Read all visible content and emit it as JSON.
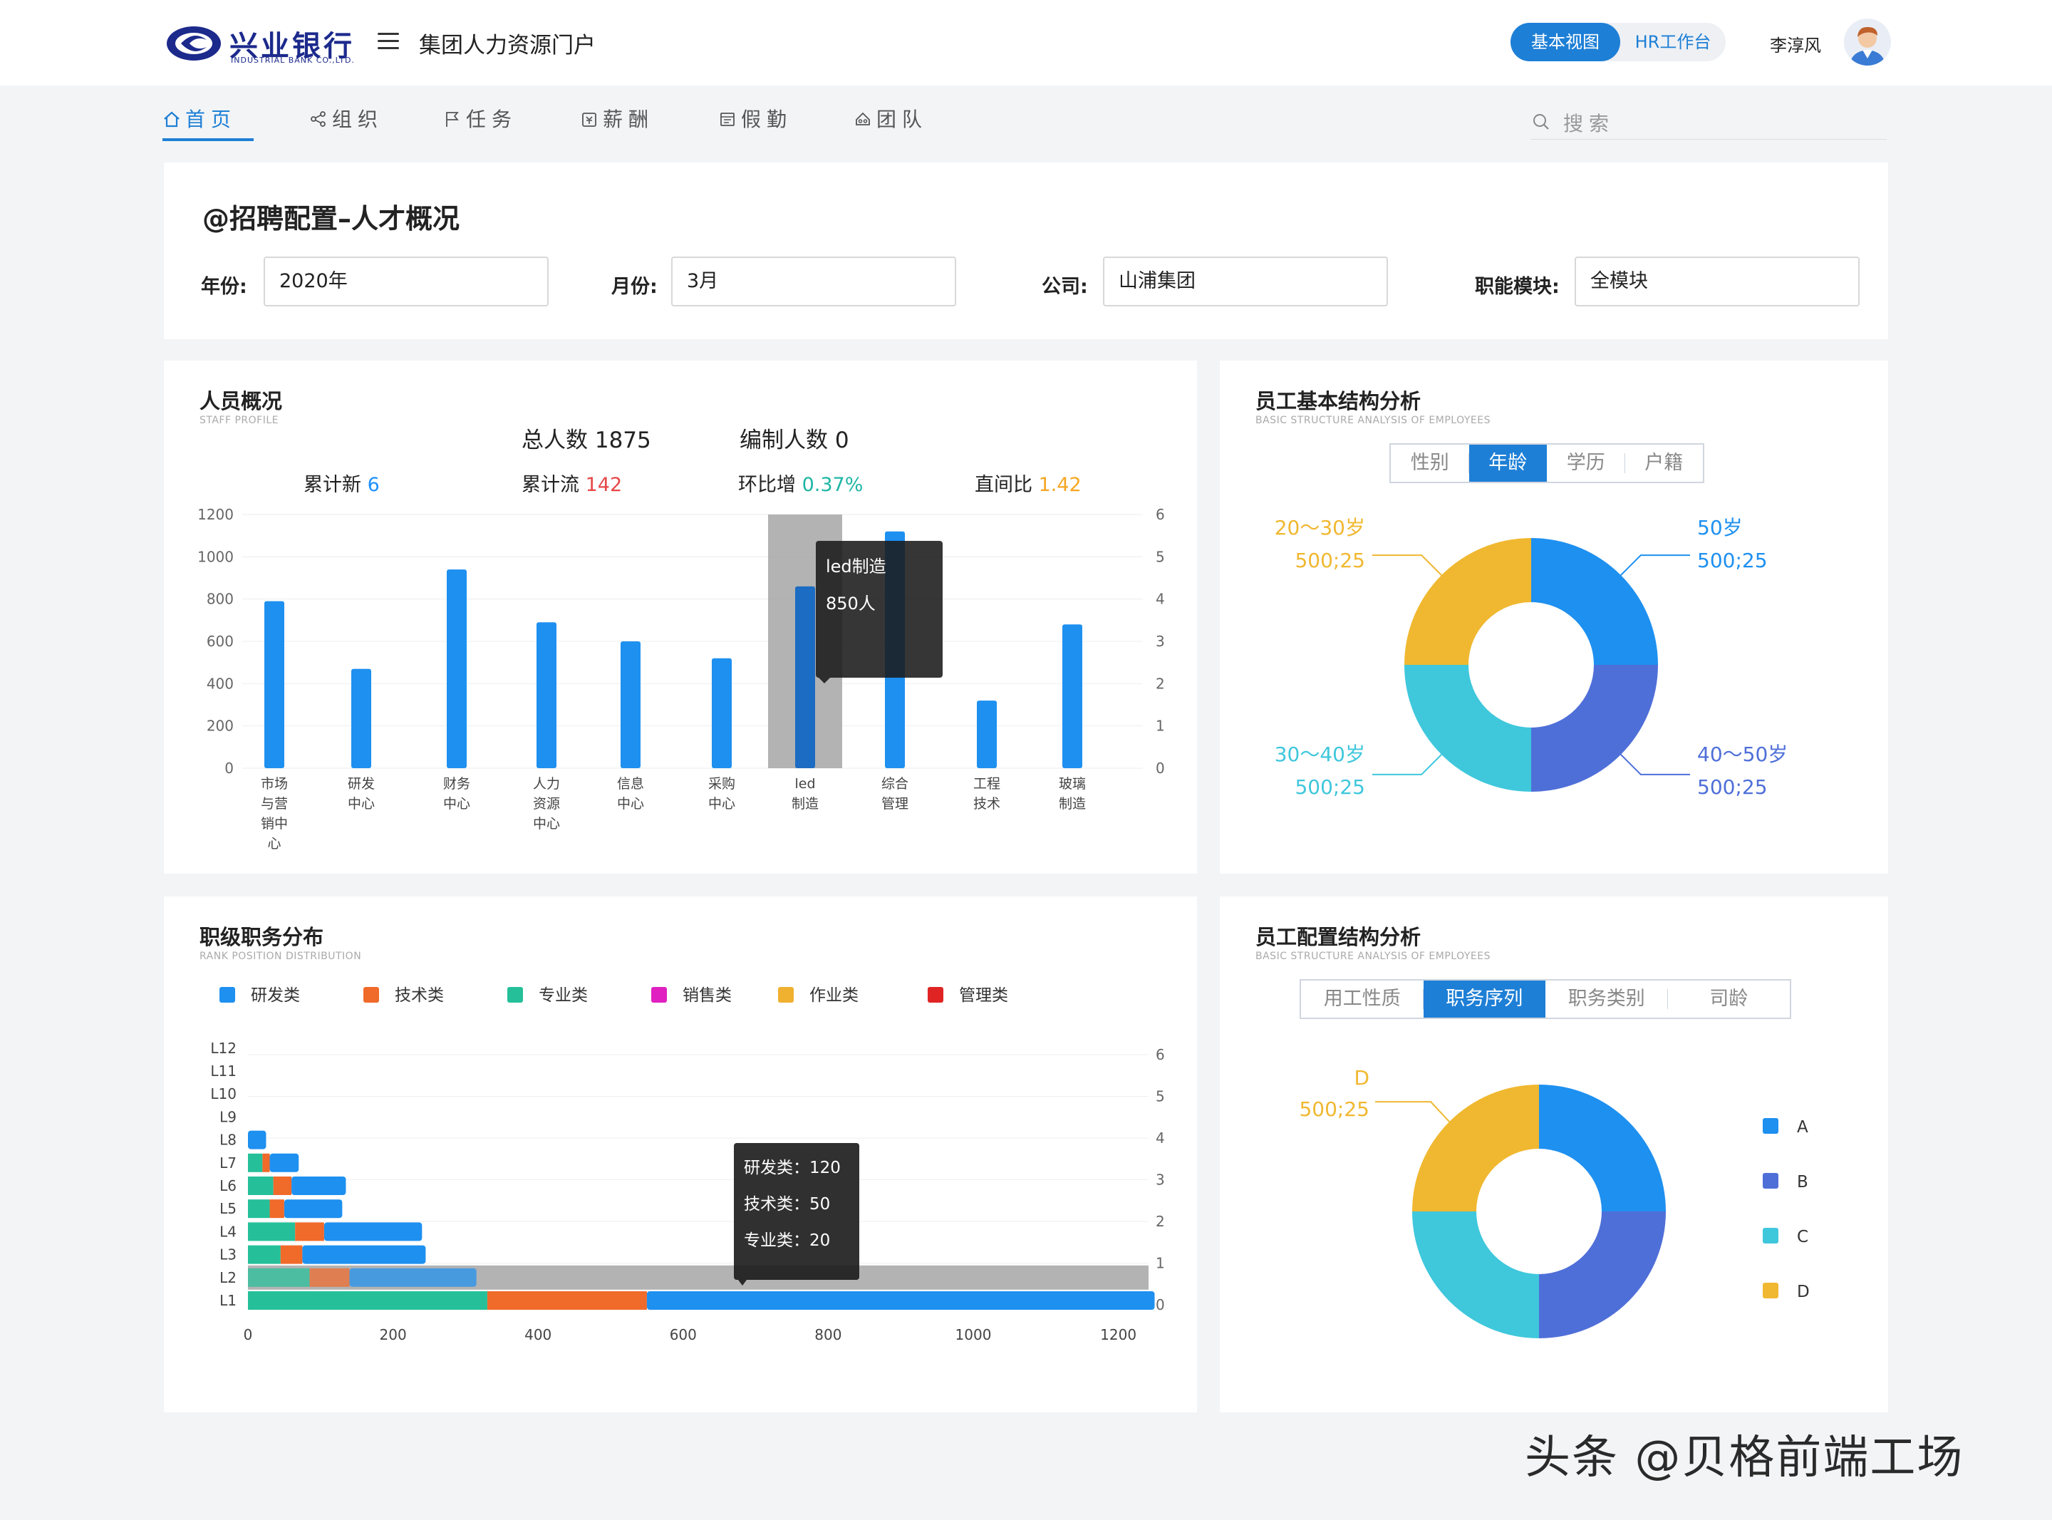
{
  "header": {
    "logo_cn": "兴业银行",
    "logo_en": "INDUSTRIAL BANK CO.,LTD.",
    "portal_title": "集团人力资源门户",
    "view_basic": "基本视图",
    "view_hr": "HR工作台",
    "user_name": "李淳风"
  },
  "nav": {
    "items": [
      {
        "label": "首页",
        "icon": "home-icon"
      },
      {
        "label": "组织",
        "icon": "share-icon"
      },
      {
        "label": "任务",
        "icon": "flag-icon"
      },
      {
        "label": "薪酬",
        "icon": "wallet-icon"
      },
      {
        "label": "假勤",
        "icon": "calendar-icon"
      },
      {
        "label": "团队",
        "icon": "team-icon"
      }
    ],
    "active_index": 0,
    "search_placeholder": "搜索"
  },
  "filter": {
    "title": "@招聘配置–人才概况",
    "year_label": "年份:",
    "year_value": "2020年",
    "month_label": "月份:",
    "month_value": "3月",
    "company_label": "公司:",
    "company_value": "山浦集团",
    "module_label": "职能模块:",
    "module_value": "全模块"
  },
  "staff": {
    "title": "人员概况",
    "subtitle": "STAFF PROFILE",
    "total_label": "总人数",
    "total_value": "1875",
    "quota_label": "编制人数",
    "quota_value": "0",
    "new_label": "累计新",
    "new_value": "6",
    "outflow_label": "累计流",
    "outflow_value": "142",
    "mom_label": "环比增",
    "mom_value": "0.37%",
    "ratio_label": "直间比",
    "ratio_value": "1.42",
    "tooltip_title": "led制造",
    "tooltip_value": "850人"
  },
  "basic": {
    "title": "员工基本结构分析",
    "subtitle": "BASIC STRUCTURE ANALYSIS OF EMPLOYEES",
    "tabs": [
      "性别",
      "年龄",
      "学历",
      "户籍"
    ],
    "active_tab": 1
  },
  "rank": {
    "title": "职级职务分布",
    "subtitle": "RANK POSITION DISTRIBUTION",
    "tooltip": [
      {
        "label": "研发类：",
        "value": "120"
      },
      {
        "label": "技术类：",
        "value": "50"
      },
      {
        "label": "专业类：",
        "value": "20"
      }
    ]
  },
  "config": {
    "title": "员工配置结构分析",
    "subtitle": "BASIC STRUCTURE ANALYSIS OF EMPLOYEES",
    "tabs": [
      "用工性质",
      "职务序列",
      "职务类别",
      "司龄"
    ],
    "active_tab": 1
  },
  "watermark": "头条 @贝格前端工场",
  "chart_data": [
    {
      "type": "bar",
      "id": "staff",
      "categories": [
        "市场与营销中心",
        "研发中心",
        "财务中心",
        "人力资源中心",
        "信息中心",
        "采购中心",
        "led制造",
        "综合管理",
        "工程技术",
        "玻璃制造"
      ],
      "category_lines": [
        [
          "市场",
          "与营",
          "销中",
          "心"
        ],
        [
          "研发",
          "中心"
        ],
        [
          "财务",
          "中心"
        ],
        [
          "人力",
          "资源",
          "中心"
        ],
        [
          "信息",
          "中心"
        ],
        [
          "采购",
          "中心"
        ],
        [
          "led",
          "制造"
        ],
        [
          "综合",
          "管理"
        ],
        [
          "工程",
          "技术"
        ],
        [
          "玻璃",
          "制造"
        ]
      ],
      "values": [
        790,
        470,
        940,
        690,
        600,
        520,
        860,
        1120,
        320,
        680
      ],
      "ylim": [
        0,
        1200
      ],
      "yticks": [
        0,
        200,
        400,
        600,
        800,
        1000,
        1200
      ],
      "y2ticks": [
        0,
        1,
        2,
        3,
        4,
        5,
        6
      ],
      "highlight_index": 6,
      "color": "#1e90f0"
    },
    {
      "type": "pie",
      "id": "age",
      "slices": [
        {
          "name": "50岁",
          "value": 500,
          "pct": 25,
          "label": "500;25",
          "color": "#1e90f0"
        },
        {
          "name": "40～50岁",
          "value": 500,
          "pct": 25,
          "label": "500;25",
          "color": "#4f6fd8"
        },
        {
          "name": "30～40岁",
          "value": 500,
          "pct": 25,
          "label": "500;25",
          "color": "#3fc7dc"
        },
        {
          "name": "20～30岁",
          "value": 500,
          "pct": 25,
          "label": "500;25",
          "color": "#f0b830"
        }
      ]
    },
    {
      "type": "bar",
      "id": "rank",
      "orientation": "horizontal",
      "stacked": true,
      "categories": [
        "L1",
        "L2",
        "L3",
        "L4",
        "L5",
        "L6",
        "L7",
        "L8",
        "L9",
        "L10",
        "L11",
        "L12"
      ],
      "legend": [
        "研发类",
        "技术类",
        "专业类",
        "销售类",
        "作业类",
        "管理类"
      ],
      "legend_colors": [
        "#1e90f0",
        "#f06a2a",
        "#25c09a",
        "#e020c0",
        "#f0b030",
        "#e02424"
      ],
      "series": [
        {
          "name": "专业类",
          "color": "#25c09a",
          "values": [
            330,
            85,
            45,
            65,
            30,
            35,
            20,
            0,
            0,
            0,
            0,
            0
          ]
        },
        {
          "name": "技术类",
          "color": "#f06a2a",
          "values": [
            220,
            55,
            30,
            40,
            20,
            25,
            10,
            0,
            0,
            0,
            0,
            0
          ]
        },
        {
          "name": "研发类",
          "color": "#1e90f0",
          "values": [
            700,
            175,
            170,
            135,
            80,
            75,
            40,
            25,
            0,
            0,
            0,
            0
          ]
        }
      ],
      "xticks": [
        0,
        200,
        400,
        600,
        800,
        1000,
        1200
      ],
      "xlim": [
        0,
        1300
      ],
      "y2ticks": [
        0,
        1,
        2,
        3,
        4,
        5,
        6
      ],
      "highlight_index": 1
    },
    {
      "type": "pie",
      "id": "config",
      "slices": [
        {
          "name": "A",
          "value": 500,
          "pct": 25,
          "color": "#1e90f0"
        },
        {
          "name": "B",
          "value": 500,
          "pct": 25,
          "color": "#4f6fd8"
        },
        {
          "name": "C",
          "value": 500,
          "pct": 25,
          "color": "#3fc7dc"
        },
        {
          "name": "D",
          "value": 500,
          "pct": 25,
          "label": "500;25",
          "color": "#f0b830"
        }
      ],
      "legend": [
        "A",
        "B",
        "C",
        "D"
      ]
    }
  ]
}
